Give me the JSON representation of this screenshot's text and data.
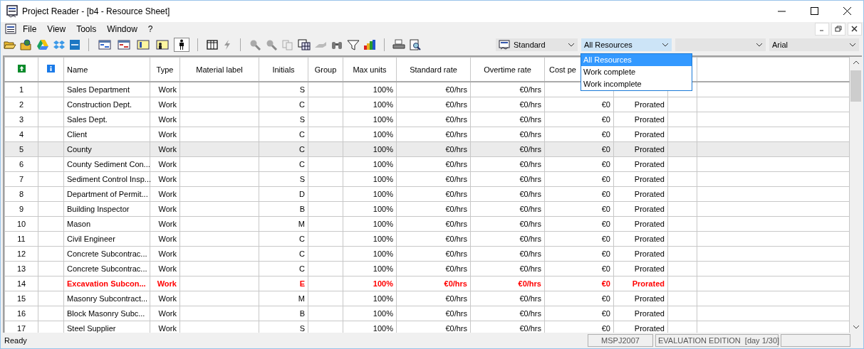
{
  "window": {
    "title": "Project Reader - [b4 - Resource Sheet]"
  },
  "menu": [
    "File",
    "View",
    "Tools",
    "Window",
    "?"
  ],
  "views": [
    {
      "selected": false
    },
    {
      "selected": false
    },
    {
      "selected": false
    },
    {
      "selected": false
    },
    {
      "selected": true
    }
  ],
  "combos": [
    {
      "kind": "icon",
      "value": "Standard"
    },
    {
      "kind": "open",
      "value": "All Resources"
    },
    {
      "kind": "plain"
    },
    {
      "kind": "plain",
      "value": "Arial"
    }
  ],
  "dropdown": {
    "options": [
      {
        "label": "All Resources",
        "selected": true
      },
      {
        "label": "Work complete",
        "selected": false
      },
      {
        "label": "Work incomplete",
        "selected": false
      }
    ]
  },
  "table": {
    "columns": [
      "",
      "",
      "Name",
      "Type",
      "Material label",
      "Initials",
      "Group",
      "Max units",
      "Standard rate",
      "Overtime rate",
      "Cost pe"
    ],
    "rows": [
      {
        "id": "1",
        "name": "Sales Department",
        "type": "Work",
        "initials": "S",
        "max_units": "100%",
        "std_rate": "€0/hrs",
        "ovt_rate": "€0/hrs",
        "selected": false,
        "overallocated": false
      },
      {
        "id": "2",
        "name": "Construction Dept.",
        "type": "Work",
        "initials": "C",
        "max_units": "100%",
        "std_rate": "€0/hrs",
        "ovt_rate": "€0/hrs",
        "cost_per_use": "€0",
        "accrue": "Prorated",
        "selected": false,
        "overallocated": false
      },
      {
        "id": "3",
        "name": "Sales Dept.",
        "type": "Work",
        "initials": "S",
        "max_units": "100%",
        "std_rate": "€0/hrs",
        "ovt_rate": "€0/hrs",
        "cost_per_use": "€0",
        "accrue": "Prorated",
        "selected": false,
        "overallocated": false
      },
      {
        "id": "4",
        "name": "Client",
        "type": "Work",
        "initials": "C",
        "max_units": "100%",
        "std_rate": "€0/hrs",
        "ovt_rate": "€0/hrs",
        "cost_per_use": "€0",
        "accrue": "Prorated",
        "selected": false,
        "overallocated": false
      },
      {
        "id": "5",
        "name": "County",
        "type": "Work",
        "initials": "C",
        "max_units": "100%",
        "std_rate": "€0/hrs",
        "ovt_rate": "€0/hrs",
        "cost_per_use": "€0",
        "accrue": "Prorated",
        "selected": true,
        "overallocated": false
      },
      {
        "id": "6",
        "name": "County Sediment Con...",
        "type": "Work",
        "initials": "C",
        "max_units": "100%",
        "std_rate": "€0/hrs",
        "ovt_rate": "€0/hrs",
        "cost_per_use": "€0",
        "accrue": "Prorated",
        "selected": false,
        "overallocated": false
      },
      {
        "id": "7",
        "name": "Sediment Control Insp...",
        "type": "Work",
        "initials": "S",
        "max_units": "100%",
        "std_rate": "€0/hrs",
        "ovt_rate": "€0/hrs",
        "cost_per_use": "€0",
        "accrue": "Prorated",
        "selected": false,
        "overallocated": false
      },
      {
        "id": "8",
        "name": "Department of Permit...",
        "type": "Work",
        "initials": "D",
        "max_units": "100%",
        "std_rate": "€0/hrs",
        "ovt_rate": "€0/hrs",
        "cost_per_use": "€0",
        "accrue": "Prorated",
        "selected": false,
        "overallocated": false
      },
      {
        "id": "9",
        "name": "Building Inspector",
        "type": "Work",
        "initials": "B",
        "max_units": "100%",
        "std_rate": "€0/hrs",
        "ovt_rate": "€0/hrs",
        "cost_per_use": "€0",
        "accrue": "Prorated",
        "selected": false,
        "overallocated": false
      },
      {
        "id": "10",
        "name": "Mason",
        "type": "Work",
        "initials": "M",
        "max_units": "100%",
        "std_rate": "€0/hrs",
        "ovt_rate": "€0/hrs",
        "cost_per_use": "€0",
        "accrue": "Prorated",
        "selected": false,
        "overallocated": false
      },
      {
        "id": "11",
        "name": "Civil Engineer",
        "type": "Work",
        "initials": "C",
        "max_units": "100%",
        "std_rate": "€0/hrs",
        "ovt_rate": "€0/hrs",
        "cost_per_use": "€0",
        "accrue": "Prorated",
        "selected": false,
        "overallocated": false
      },
      {
        "id": "12",
        "name": "Concrete Subcontrac...",
        "type": "Work",
        "initials": "C",
        "max_units": "100%",
        "std_rate": "€0/hrs",
        "ovt_rate": "€0/hrs",
        "cost_per_use": "€0",
        "accrue": "Prorated",
        "selected": false,
        "overallocated": false
      },
      {
        "id": "13",
        "name": "Concrete Subcontrac...",
        "type": "Work",
        "initials": "C",
        "max_units": "100%",
        "std_rate": "€0/hrs",
        "ovt_rate": "€0/hrs",
        "cost_per_use": "€0",
        "accrue": "Prorated",
        "selected": false,
        "overallocated": false
      },
      {
        "id": "14",
        "name": "Excavation Subcon...",
        "type": "Work",
        "initials": "E",
        "max_units": "100%",
        "std_rate": "€0/hrs",
        "ovt_rate": "€0/hrs",
        "cost_per_use": "€0",
        "accrue": "Prorated",
        "selected": false,
        "overallocated": true
      },
      {
        "id": "15",
        "name": "Masonry Subcontract...",
        "type": "Work",
        "initials": "M",
        "max_units": "100%",
        "std_rate": "€0/hrs",
        "ovt_rate": "€0/hrs",
        "cost_per_use": "€0",
        "accrue": "Prorated",
        "selected": false,
        "overallocated": false
      },
      {
        "id": "16",
        "name": "Block Masonry Subc...",
        "type": "Work",
        "initials": "B",
        "max_units": "100%",
        "std_rate": "€0/hrs",
        "ovt_rate": "€0/hrs",
        "cost_per_use": "€0",
        "accrue": "Prorated",
        "selected": false,
        "overallocated": false
      },
      {
        "id": "17",
        "name": "Steel Supplier",
        "type": "Work",
        "initials": "S",
        "max_units": "100%",
        "std_rate": "€0/hrs",
        "ovt_rate": "€0/hrs",
        "cost_per_use": "€0",
        "accrue": "Prorated",
        "selected": false,
        "overallocated": false
      }
    ]
  },
  "status_bar": {
    "message": "Ready",
    "format": "MSPJ2007",
    "edition": "EVALUATION EDITION  [day 1/30]"
  }
}
